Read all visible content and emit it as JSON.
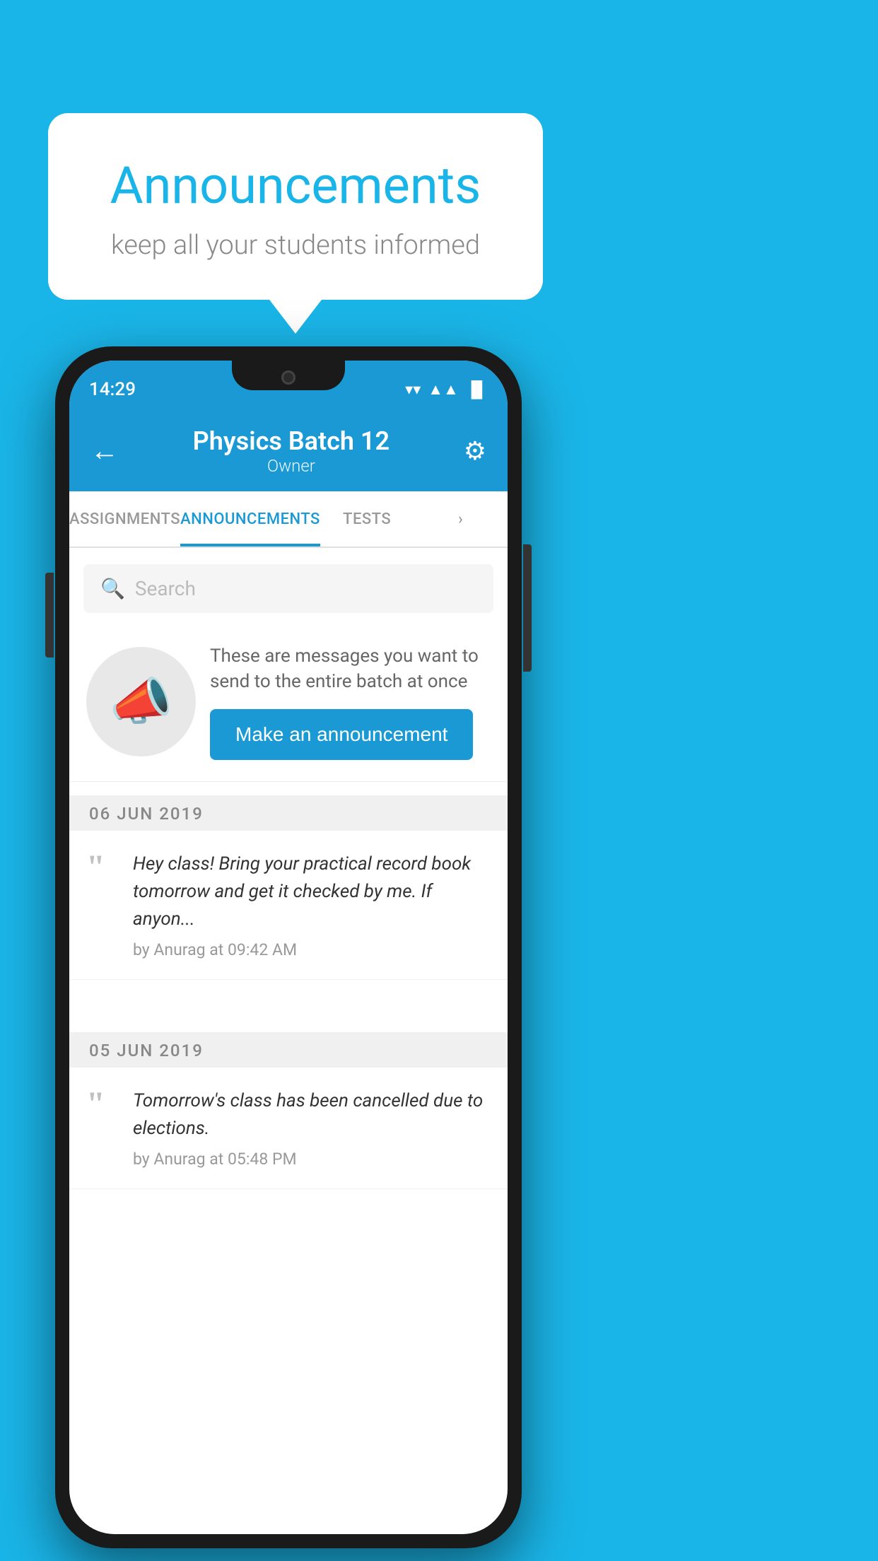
{
  "speech_bubble": {
    "title": "Announcements",
    "subtitle": "keep all your students informed"
  },
  "status_bar": {
    "time": "14:29",
    "wifi": "▼",
    "signal": "▲",
    "battery": "▐"
  },
  "header": {
    "title": "Physics Batch 12",
    "subtitle": "Owner",
    "back_label": "←",
    "gear_label": "⚙"
  },
  "tabs": [
    {
      "label": "ASSIGNMENTS",
      "active": false
    },
    {
      "label": "ANNOUNCEMENTS",
      "active": true
    },
    {
      "label": "TESTS",
      "active": false
    },
    {
      "label": "›",
      "active": false
    }
  ],
  "search": {
    "placeholder": "Search"
  },
  "promo": {
    "description": "These are messages you want to send to the entire batch at once",
    "button_label": "Make an announcement"
  },
  "announcements": [
    {
      "date": "06  JUN  2019",
      "text": "Hey class! Bring your practical record book tomorrow and get it checked by me. If anyon...",
      "author": "by Anurag at 09:42 AM"
    },
    {
      "date": "05  JUN  2019",
      "text": "Tomorrow's class has been cancelled due to elections.",
      "author": "by Anurag at 05:48 PM"
    }
  ],
  "colors": {
    "brand_blue": "#1a99d4",
    "background_blue": "#1ab5e8"
  }
}
